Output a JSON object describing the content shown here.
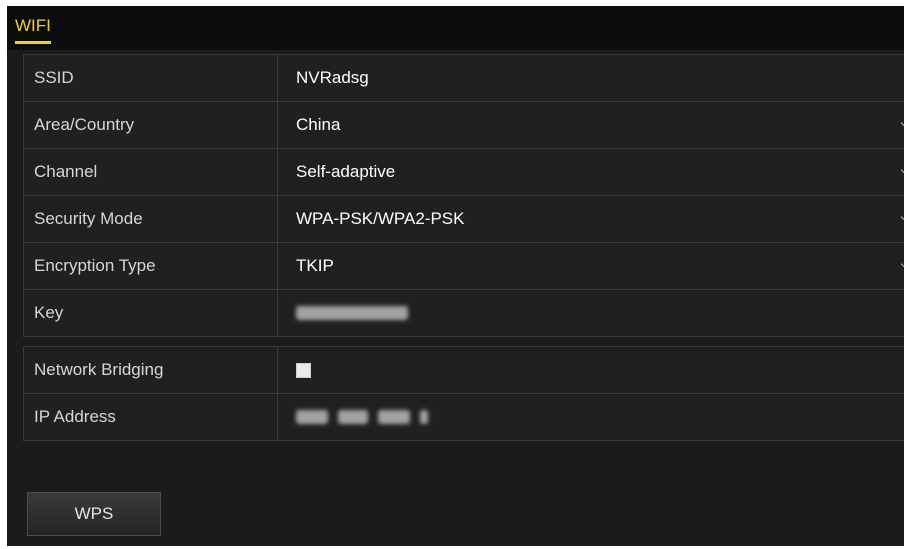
{
  "tabs": [
    {
      "label": "WIFI",
      "active": true
    }
  ],
  "fields": [
    {
      "label": "SSID",
      "value": "NVRadsg",
      "type": "text"
    },
    {
      "label": "Area/Country",
      "value": "China",
      "type": "dropdown"
    },
    {
      "label": "Channel",
      "value": "Self-adaptive",
      "type": "dropdown"
    },
    {
      "label": "Security Mode",
      "value": "WPA-PSK/WPA2-PSK",
      "type": "dropdown"
    },
    {
      "label": "Encryption Type",
      "value": "TKIP",
      "type": "dropdown"
    },
    {
      "label": "Key",
      "value": "",
      "type": "masked"
    }
  ],
  "network": [
    {
      "label": "Network Bridging",
      "checked": false,
      "type": "checkbox"
    },
    {
      "label": "IP Address",
      "value": "",
      "type": "masked"
    }
  ],
  "buttons": {
    "wps_label": "WPS"
  },
  "colors": {
    "accent": "#f2d21d",
    "background": "#1b1b1b",
    "panel": "#202020",
    "text": "#d6d6d6"
  }
}
